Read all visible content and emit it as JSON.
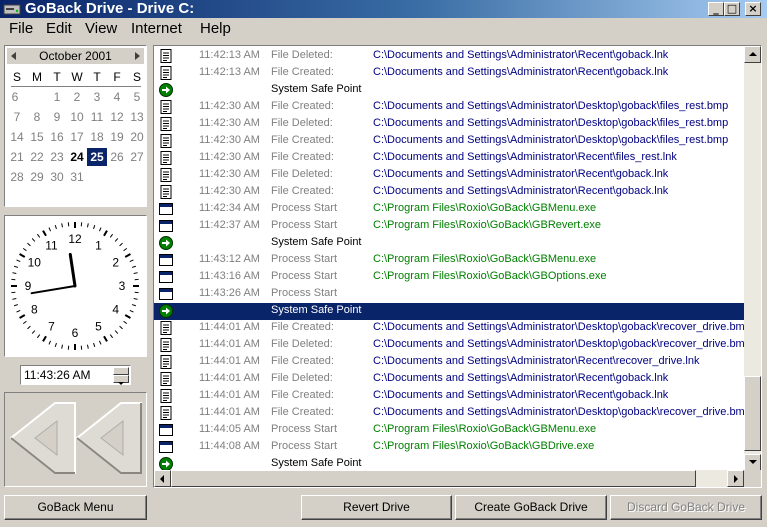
{
  "window": {
    "title": "GoBack Drive - Drive C:",
    "min": "_",
    "max": "□",
    "close": "×"
  },
  "menu": [
    "File",
    "Edit",
    "View",
    "Internet",
    "Help"
  ],
  "calendar": {
    "month": "October 2001",
    "dow": [
      "S",
      "M",
      "T",
      "W",
      "T",
      "F",
      "S"
    ],
    "weeks": [
      [
        "",
        "",
        "1",
        "2",
        "3",
        "4",
        "5",
        "6"
      ],
      [
        "7",
        "8",
        "9",
        "10",
        "11",
        "12",
        "13"
      ],
      [
        "14",
        "15",
        "16",
        "17",
        "18",
        "19",
        "20"
      ],
      [
        "21",
        "22",
        "23",
        "24",
        "25",
        "26",
        "27"
      ],
      [
        "28",
        "29",
        "30",
        "31",
        "",
        "",
        ""
      ]
    ],
    "bold_day": "24",
    "selected_day": "25"
  },
  "clock": {
    "numbers": [
      "12",
      "1",
      "2",
      "3",
      "4",
      "5",
      "6",
      "7",
      "8",
      "9",
      "10",
      "11"
    ]
  },
  "time": {
    "value": "11:43:26 AM"
  },
  "log": {
    "rows": [
      {
        "icon": "doc",
        "time": "11:42:13 AM",
        "type": "File Deleted:",
        "path": "C:\\Documents and Settings\\Administrator\\Recent\\goback.lnk",
        "color": "blue"
      },
      {
        "icon": "doc",
        "time": "11:42:13 AM",
        "type": "File Created:",
        "path": "C:\\Documents and Settings\\Administrator\\Recent\\goback.lnk",
        "color": "blue"
      },
      {
        "icon": "safe",
        "label": "System Safe Point"
      },
      {
        "icon": "doc",
        "time": "11:42:30 AM",
        "type": "File Created:",
        "path": "C:\\Documents and Settings\\Administrator\\Desktop\\goback\\files_rest.bmp",
        "color": "blue"
      },
      {
        "icon": "doc",
        "time": "11:42:30 AM",
        "type": "File Deleted:",
        "path": "C:\\Documents and Settings\\Administrator\\Desktop\\goback\\files_rest.bmp",
        "color": "blue"
      },
      {
        "icon": "doc",
        "time": "11:42:30 AM",
        "type": "File Created:",
        "path": "C:\\Documents and Settings\\Administrator\\Desktop\\goback\\files_rest.bmp",
        "color": "blue"
      },
      {
        "icon": "doc",
        "time": "11:42:30 AM",
        "type": "File Created:",
        "path": "C:\\Documents and Settings\\Administrator\\Recent\\files_rest.lnk",
        "color": "blue"
      },
      {
        "icon": "doc",
        "time": "11:42:30 AM",
        "type": "File Deleted:",
        "path": "C:\\Documents and Settings\\Administrator\\Recent\\goback.lnk",
        "color": "blue"
      },
      {
        "icon": "doc",
        "time": "11:42:30 AM",
        "type": "File Created:",
        "path": "C:\\Documents and Settings\\Administrator\\Recent\\goback.lnk",
        "color": "blue"
      },
      {
        "icon": "proc",
        "time": "11:42:34 AM",
        "type": "Process Start",
        "path": "C:\\Program Files\\Roxio\\GoBack\\GBMenu.exe",
        "color": "green"
      },
      {
        "icon": "proc",
        "time": "11:42:37 AM",
        "type": "Process Start",
        "path": "C:\\Program Files\\Roxio\\GoBack\\GBRevert.exe",
        "color": "green"
      },
      {
        "icon": "safe",
        "label": "System Safe Point"
      },
      {
        "icon": "proc",
        "time": "11:43:12 AM",
        "type": "Process Start",
        "path": "C:\\Program Files\\Roxio\\GoBack\\GBMenu.exe",
        "color": "green"
      },
      {
        "icon": "proc",
        "time": "11:43:16 AM",
        "type": "Process Start",
        "path": "C:\\Program Files\\Roxio\\GoBack\\GBOptions.exe",
        "color": "green"
      },
      {
        "icon": "proc",
        "time": "11:43:26 AM",
        "type": "Process Start",
        "path": "",
        "color": "green"
      },
      {
        "icon": "safe",
        "label": "System Safe Point",
        "selected": true
      },
      {
        "icon": "doc",
        "time": "11:44:01 AM",
        "type": "File Created:",
        "path": "C:\\Documents and Settings\\Administrator\\Desktop\\goback\\recover_drive.bmp",
        "color": "blue"
      },
      {
        "icon": "doc",
        "time": "11:44:01 AM",
        "type": "File Deleted:",
        "path": "C:\\Documents and Settings\\Administrator\\Desktop\\goback\\recover_drive.bmp",
        "color": "blue"
      },
      {
        "icon": "doc",
        "time": "11:44:01 AM",
        "type": "File Created:",
        "path": "C:\\Documents and Settings\\Administrator\\Recent\\recover_drive.lnk",
        "color": "blue"
      },
      {
        "icon": "doc",
        "time": "11:44:01 AM",
        "type": "File Deleted:",
        "path": "C:\\Documents and Settings\\Administrator\\Recent\\goback.lnk",
        "color": "blue"
      },
      {
        "icon": "doc",
        "time": "11:44:01 AM",
        "type": "File Created:",
        "path": "C:\\Documents and Settings\\Administrator\\Recent\\goback.lnk",
        "color": "blue"
      },
      {
        "icon": "doc",
        "time": "11:44:01 AM",
        "type": "File Created:",
        "path": "C:\\Documents and Settings\\Administrator\\Desktop\\goback\\recover_drive.bmp",
        "color": "blue"
      },
      {
        "icon": "proc",
        "time": "11:44:05 AM",
        "type": "Process Start",
        "path": "C:\\Program Files\\Roxio\\GoBack\\GBMenu.exe",
        "color": "green"
      },
      {
        "icon": "proc",
        "time": "11:44:08 AM",
        "type": "Process Start",
        "path": "C:\\Program Files\\Roxio\\GoBack\\GBDrive.exe",
        "color": "green"
      },
      {
        "icon": "safe",
        "label": "System Safe Point"
      }
    ]
  },
  "buttons": {
    "goback_menu": "GoBack Menu",
    "revert_drive": "Revert Drive",
    "create_goback_drive": "Create GoBack Drive",
    "discard_goback_drive": "Discard GoBack Drive"
  },
  "colors": {
    "selection": "#0a246a",
    "path_blue": "#000080",
    "path_green": "#008000",
    "safe_green": "#008000"
  },
  "icons": {
    "doc": "document-icon",
    "proc": "process-window-icon",
    "safe": "safe-point-arrow-icon"
  }
}
